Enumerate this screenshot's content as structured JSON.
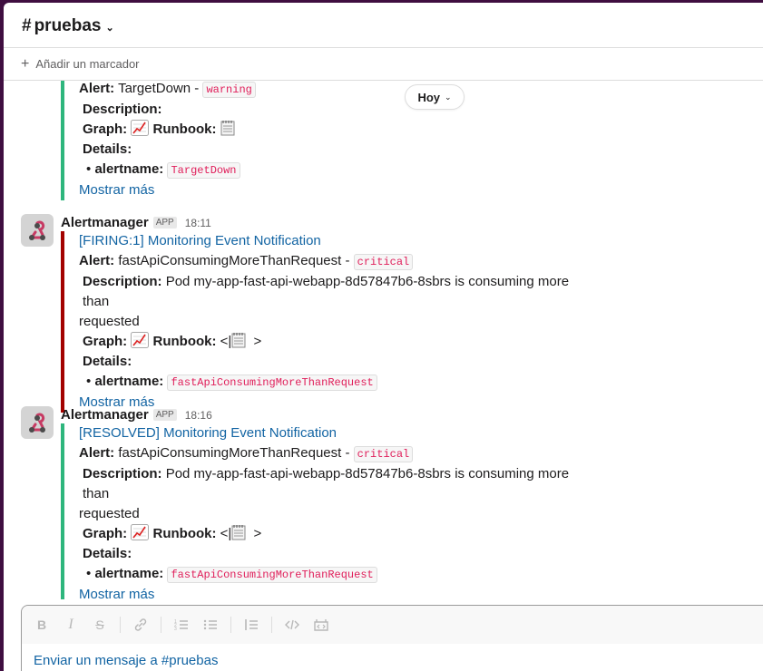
{
  "header": {
    "channel_hash": "#",
    "channel_name": "pruebas"
  },
  "bookmark": {
    "label": "Añadir un marcador"
  },
  "date_pill": {
    "label": "Hoy"
  },
  "first_message": {
    "alert_label": "Alert:",
    "alert_text": "TargetDown -",
    "alert_severity": "warning",
    "description_label": "Description:",
    "graph_label": "Graph:",
    "runbook_label": "Runbook:",
    "details_label": "Details:",
    "alertname_label": "alertname:",
    "alertname_value": "TargetDown",
    "more_label": "Mostrar más"
  },
  "messages": [
    {
      "sender": "Alertmanager",
      "badge": "APP",
      "time": "18:11",
      "title": "[FIRING:1] Monitoring Event Notification",
      "alert_label": "Alert:",
      "alert_text": "fastApiConsumingMoreThanRequest -",
      "alert_severity": "critical",
      "description_label": "Description:",
      "description_text": "Pod my-app-fast-api-webapp-8d57847b6-8sbrs is consuming more than",
      "description_cont": "requested",
      "graph_label": "Graph:",
      "runbook_label": "Runbook:",
      "runbook_prefix": "<|",
      "runbook_suffix": ">",
      "details_label": "Details:",
      "alertname_label": "alertname:",
      "alertname_value": "fastApiConsumingMoreThanRequest",
      "more_label": "Mostrar más",
      "bar_color": "#a30200"
    },
    {
      "sender": "Alertmanager",
      "badge": "APP",
      "time": "18:16",
      "title": "[RESOLVED] Monitoring Event Notification",
      "alert_label": "Alert:",
      "alert_text": "fastApiConsumingMoreThanRequest -",
      "alert_severity": "critical",
      "description_label": "Description:",
      "description_text": "Pod my-app-fast-api-webapp-8d57847b6-8sbrs is consuming more than",
      "description_cont": "requested",
      "graph_label": "Graph:",
      "runbook_label": "Runbook:",
      "runbook_prefix": "<|",
      "runbook_suffix": ">",
      "details_label": "Details:",
      "alertname_label": "alertname:",
      "alertname_value": "fastApiConsumingMoreThanRequest",
      "more_label": "Mostrar más",
      "bar_color": "#2eb67d"
    }
  ],
  "composer": {
    "placeholder": "Enviar un mensaje a #pruebas",
    "toolbar_icons": [
      "bold-icon",
      "italic-icon",
      "strikethrough-icon",
      "link-icon",
      "ordered-list-icon",
      "bulleted-list-icon",
      "blockquote-icon",
      "code-icon",
      "code-block-icon"
    ]
  },
  "colors": {
    "sidebar": "#3f0e40",
    "link": "#1264a3",
    "firing_bar": "#a30200",
    "resolved_bar": "#2eb67d",
    "code_text": "#e01e5a"
  }
}
